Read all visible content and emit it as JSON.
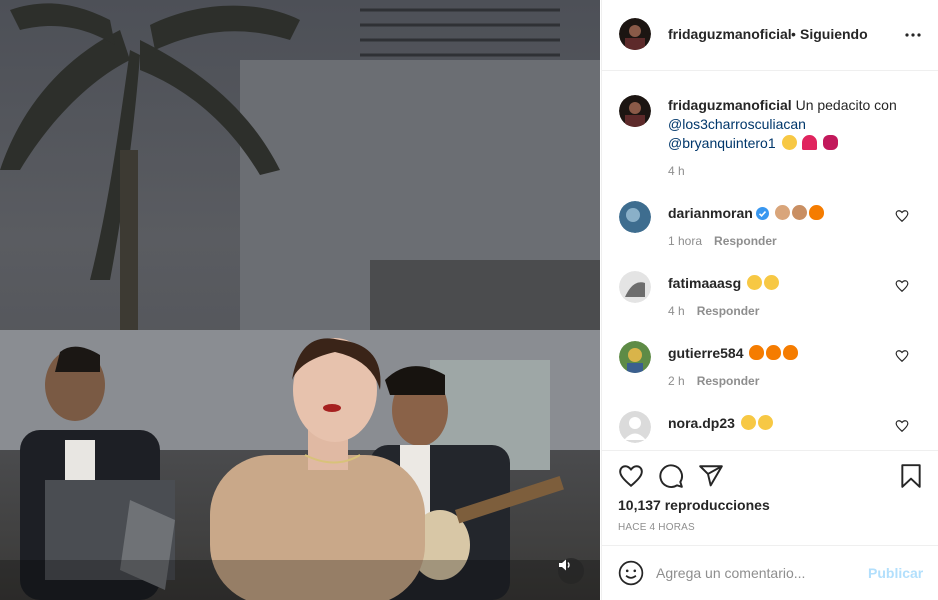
{
  "header": {
    "username": "fridaguzmanoficial",
    "separator": "•",
    "follow_status": "Siguiendo",
    "more_icon": "more-horizontal-icon"
  },
  "caption": {
    "username": "fridaguzmanoficial",
    "text": "Un pedacito con",
    "mention_1": "@los3charrosculiacan",
    "mention_2": "@bryanquintero1",
    "emojis": [
      "tongue-face",
      "red-heart",
      "lips"
    ],
    "time": "4 h"
  },
  "comments": [
    {
      "username": "darianmoran",
      "verified": true,
      "emojis": [
        "clapping-hands",
        "raised-hands",
        "fire"
      ],
      "time": "1 hora",
      "reply": "Responder"
    },
    {
      "username": "fatimaaasg",
      "verified": false,
      "emojis": [
        "heart-eyes",
        "heart-eyes"
      ],
      "time": "4 h",
      "reply": "Responder"
    },
    {
      "username": "gutierre584",
      "verified": false,
      "emojis": [
        "fire",
        "fire",
        "fire"
      ],
      "time": "2 h",
      "reply": "Responder"
    },
    {
      "username": "nora.dp23",
      "verified": false,
      "emojis": [
        "heart-eyes",
        "heart-eyes"
      ],
      "time": "",
      "reply": ""
    }
  ],
  "actions": {
    "icons": [
      "heart-icon",
      "comment-icon",
      "share-icon",
      "bookmark-icon"
    ],
    "views": "10,137 reproducciones",
    "time_ago": "HACE 4 HORAS"
  },
  "add_comment": {
    "placeholder": "Agrega un comentario...",
    "publish_label": "Publicar"
  },
  "colors": {
    "mention": "#00376b",
    "muted": "#8e8e8e",
    "publish_disabled": "#b2dffc",
    "verified": "#3897f0"
  }
}
